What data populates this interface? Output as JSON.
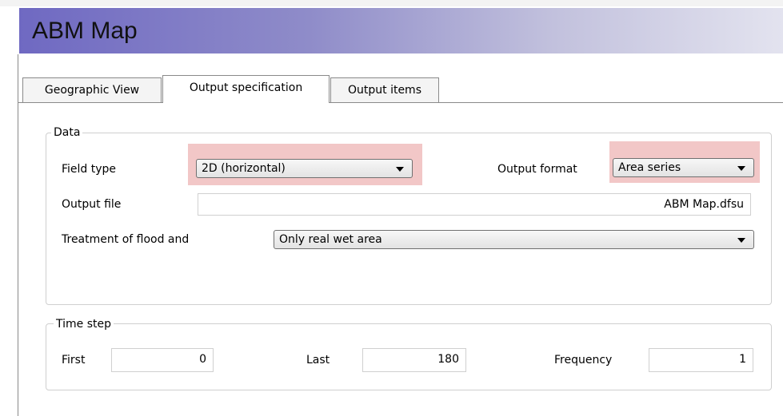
{
  "window": {
    "title": "ABM Map"
  },
  "tabs": [
    {
      "label": "Geographic View",
      "active": false
    },
    {
      "label": "Output specification",
      "active": true
    },
    {
      "label": "Output items",
      "active": false
    }
  ],
  "data_group": {
    "label": "Data",
    "field_type_label": "Field type",
    "field_type_value": "2D (horizontal)",
    "output_format_label": "Output format",
    "output_format_value": "Area series",
    "output_file_label": "Output file",
    "output_file_value": "ABM Map.dfsu",
    "flood_label": "Treatment of flood and",
    "flood_value": "Only real wet area"
  },
  "time_group": {
    "label": "Time step",
    "first_label": "First",
    "first_value": "0",
    "last_label": "Last",
    "last_value": "180",
    "frequency_label": "Frequency",
    "frequency_value": "1"
  },
  "colors": {
    "highlight": "#f2c7c7",
    "title_gradient_start": "#6f69c2"
  }
}
